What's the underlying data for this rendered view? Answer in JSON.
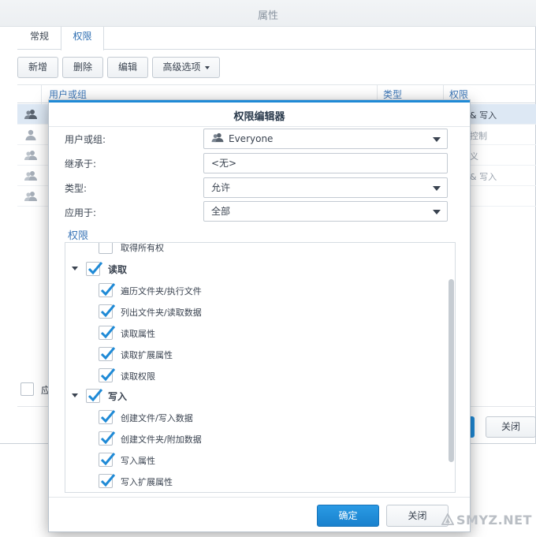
{
  "background_window": {
    "title": "属性",
    "tabs": [
      {
        "label": "常规"
      },
      {
        "label": "权限"
      }
    ],
    "toolbar": {
      "add": "新增",
      "delete": "删除",
      "edit": "编辑",
      "advanced": "高级选项"
    },
    "columns": {
      "user": "用户或组",
      "type": "类型",
      "permission": "权限"
    },
    "rows": [
      {
        "perm": "& 写入",
        "selected": true
      },
      {
        "perm": "控制",
        "selected": false
      },
      {
        "perm": "义",
        "selected": false
      },
      {
        "perm": "& 写入",
        "selected": false
      },
      {
        "perm": "",
        "selected": false
      }
    ],
    "checkbox_label": "应",
    "close_label": "关闭"
  },
  "dialog": {
    "title": "权限编辑器",
    "fields": {
      "user_label": "用户或组:",
      "user_value": "Everyone",
      "inherit_label": "继承于:",
      "inherit_value": "<无>",
      "type_label": "类型:",
      "type_value": "允许",
      "apply_label": "应用于:",
      "apply_value": "全部"
    },
    "permissions_heading": "权限",
    "permissions": {
      "take_ownership": "取得所有权",
      "read_group": "读取",
      "read_items": [
        "遍历文件夹/执行文件",
        "列出文件夹/读取数据",
        "读取属性",
        "读取扩展属性",
        "读取权限"
      ],
      "write_group": "写入",
      "write_items": [
        "创建文件/写入数据",
        "创建文件夹/附加数据",
        "写入属性",
        "写入扩展属性"
      ]
    },
    "buttons": {
      "ok": "确定",
      "close": "关闭"
    }
  },
  "watermark": "SMYZ.NET",
  "colors": {
    "accent": "#1f8ad6",
    "link": "#3b76b8",
    "selection": "#dde8f4"
  }
}
